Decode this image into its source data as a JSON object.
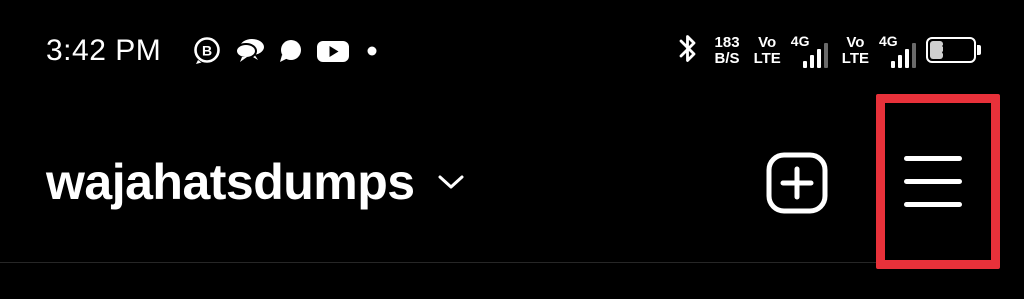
{
  "status_bar": {
    "time": "3:42 PM",
    "notification_icons": [
      "business-whatsapp-icon",
      "chat-bubbles-icon",
      "message-bubble-icon",
      "youtube-icon",
      "more-dot-icon"
    ],
    "network_speed": {
      "value": "183",
      "unit": "B/S"
    },
    "sim1": {
      "volte_top": "Vo",
      "volte_bottom": "LTE",
      "generation": "4G"
    },
    "sim2": {
      "volte_top": "Vo",
      "volte_bottom": "LTE",
      "generation": "4G"
    },
    "battery_level": "32",
    "battery_percent": 32
  },
  "header": {
    "username": "wajahatsdumps",
    "create_icon": "plus-square-icon",
    "menu_icon": "hamburger-menu-icon"
  },
  "colors": {
    "background": "#000000",
    "foreground": "#ffffff",
    "highlight": "#e8313a",
    "divider": "#262626"
  }
}
